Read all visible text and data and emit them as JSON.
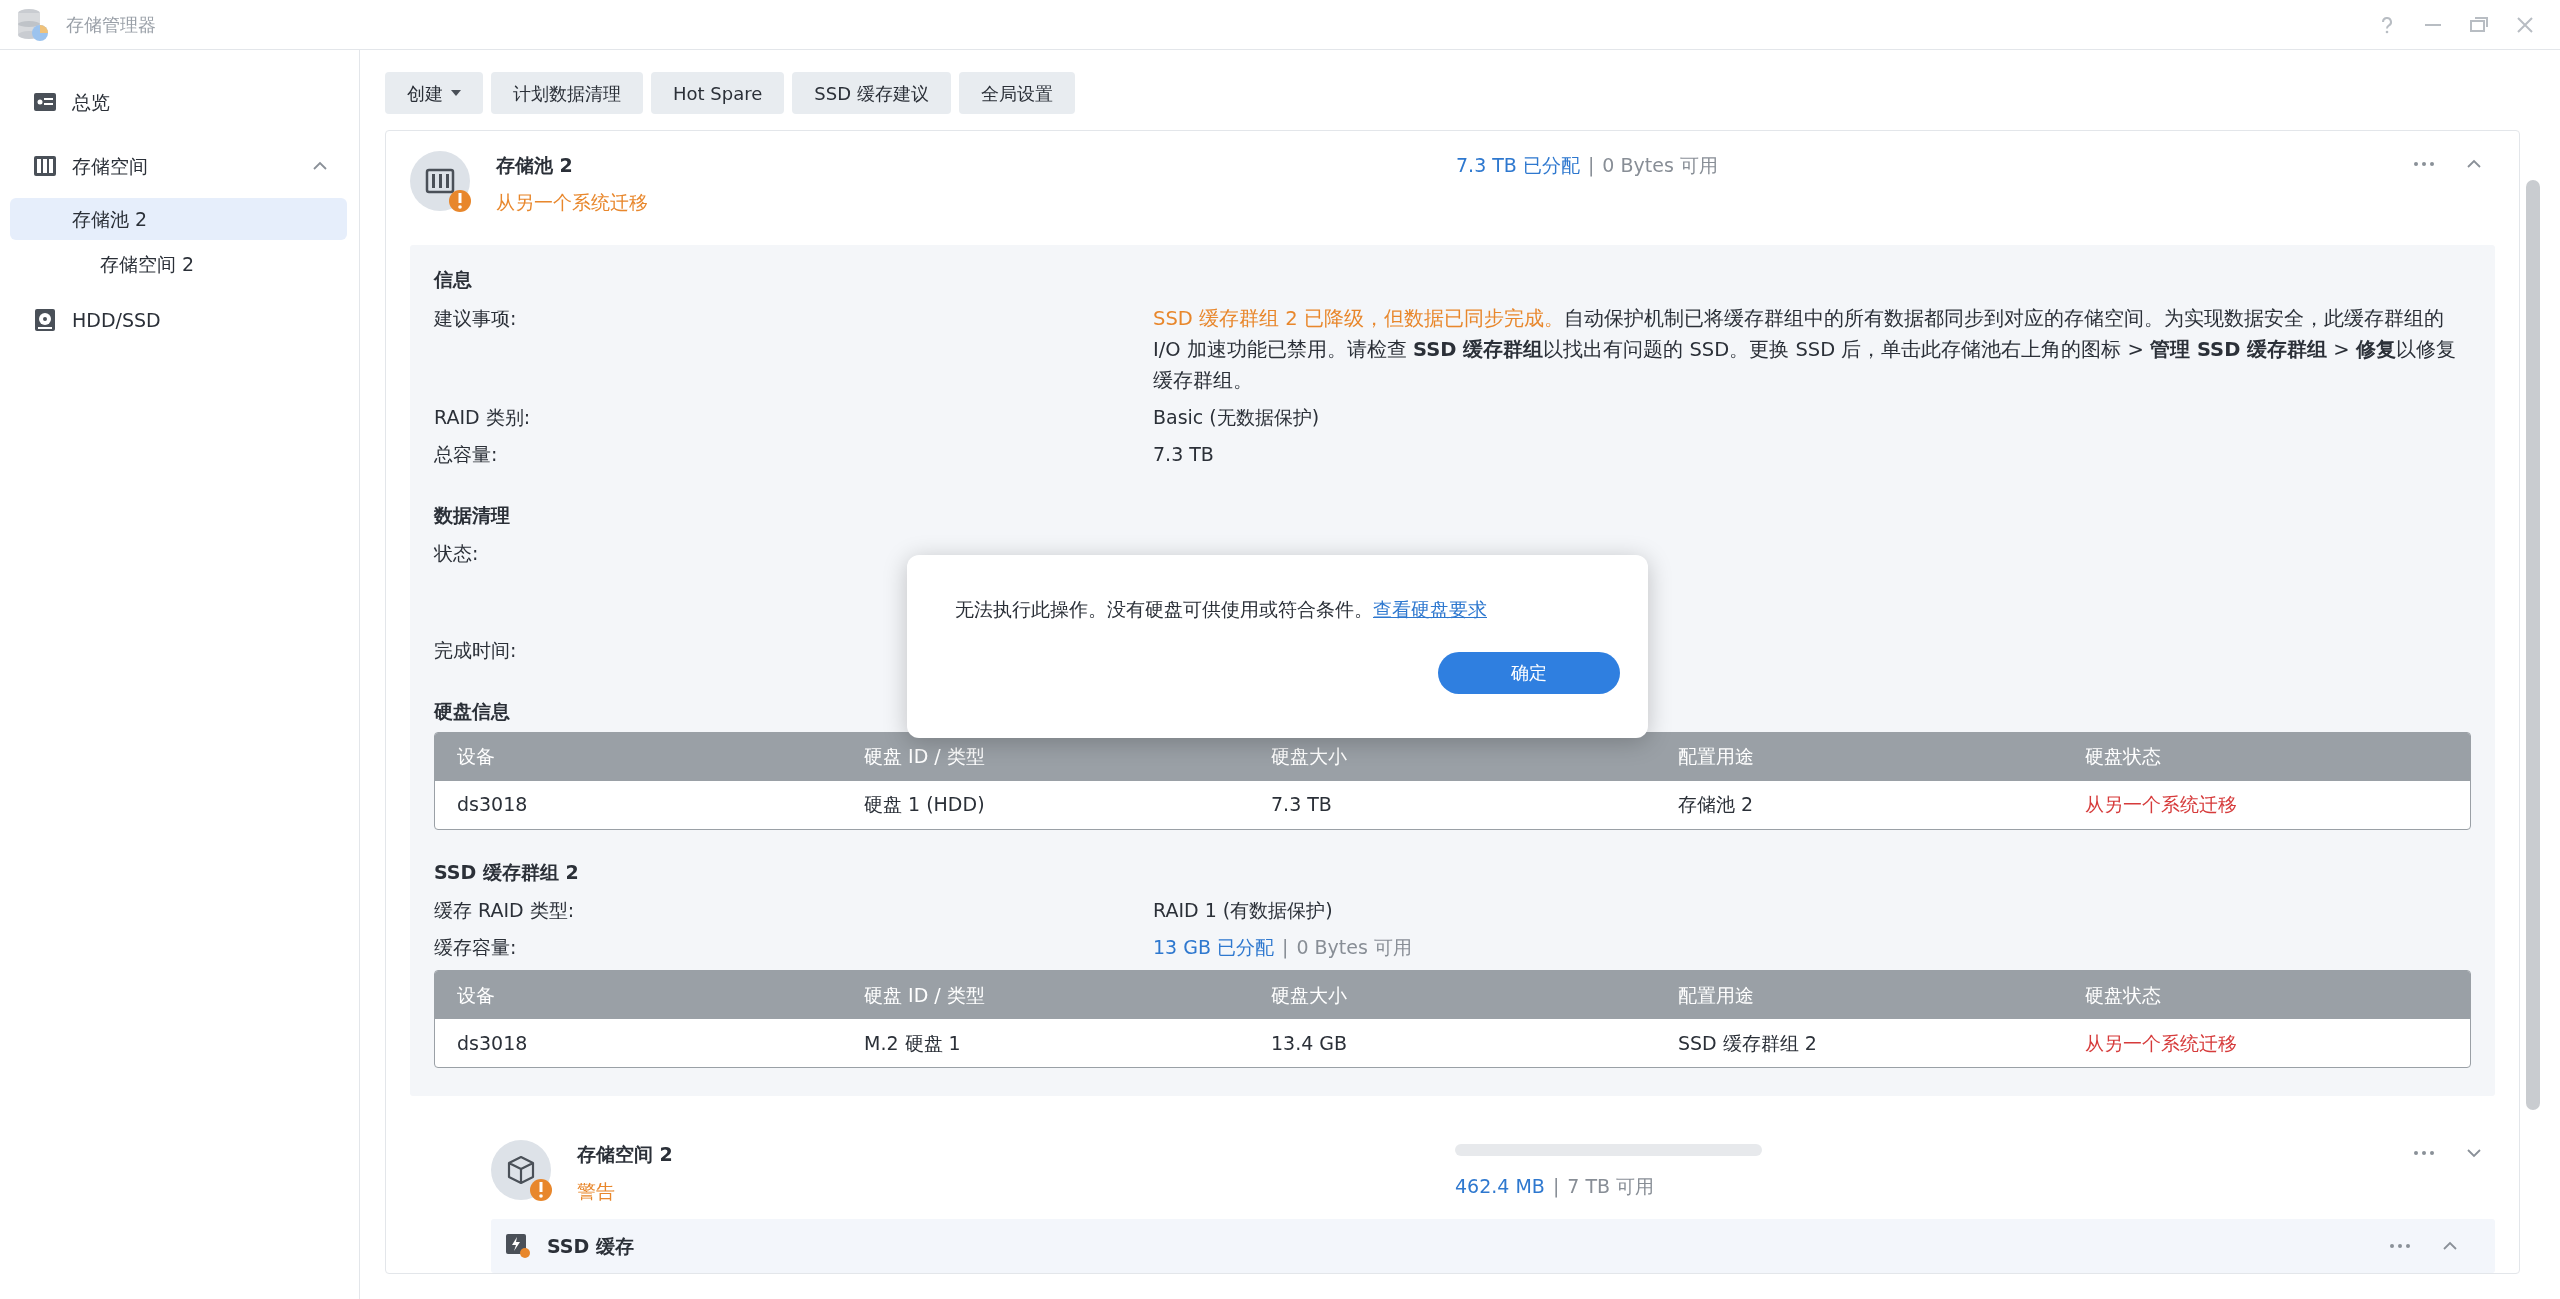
{
  "window": {
    "title": "存储管理器"
  },
  "sidebar": {
    "items": [
      {
        "label": "总览",
        "selected": false
      },
      {
        "label": "存储空间",
        "selected": false,
        "expanded": true,
        "children": [
          {
            "label": "存储池 2",
            "selected": true,
            "children": [
              {
                "label": "存储空间 2",
                "selected": false
              }
            ]
          }
        ]
      },
      {
        "label": "HDD/SSD",
        "selected": false
      }
    ]
  },
  "toolbar": [
    {
      "label": "创建",
      "dropdown": true
    },
    {
      "label": "计划数据清理",
      "dropdown": false
    },
    {
      "label": "Hot Spare",
      "dropdown": false
    },
    {
      "label": "SSD 缓存建议",
      "dropdown": false
    },
    {
      "label": "全局设置",
      "dropdown": false
    }
  ],
  "pool": {
    "name": "存储池 2",
    "status": "从另一个系统迁移",
    "warning": true,
    "allocated": "7.3 TB 已分配",
    "separator": "|",
    "available": "0 Bytes 可用",
    "expanded": true,
    "sections": [
      {
        "heading": "信息",
        "rows": [
          {
            "label": "建议事项:",
            "warning": "SSD 缓存群组 2 已降级，但数据已同步完成。",
            "value": "自动保护机制已将缓存群组中的所有数据都同步到对应的存储空间。为实现数据安全，此缓存群组的 I/O 加速功能已禁用。请检查 **SSD 缓存群组**以找出有问题的 SSD。更换 SSD 后，单击此存储池右上角的图标 > **管理 SSD 缓存群组** > **修复**以修复缓存群组。"
          },
          {
            "label": "RAID 类别:",
            "value": "Basic (无数据保护)"
          },
          {
            "label": "总容量:",
            "value": "7.3 TB"
          }
        ]
      },
      {
        "heading": "数据清理",
        "rows": [
          {
            "label": "状态:"
          },
          {
            "label": "完成时间:"
          }
        ]
      },
      {
        "heading": "硬盘信息",
        "table": {
          "columns": [
            "设备",
            "硬盘 ID / 类型",
            "硬盘大小",
            "配置用途",
            "硬盘状态"
          ],
          "rows": [
            [
              "ds3018",
              "硬盘 1 (HDD)",
              "7.3 TB",
              "存储池 2",
              "从另一个系统迁移"
            ]
          ]
        }
      },
      {
        "heading": "SSD 缓存群组 2",
        "rows": [
          {
            "label": "缓存 RAID 类型:",
            "value": "RAID 1 (有数据保护)"
          },
          {
            "label": "缓存容量:",
            "allocated": "13 GB 已分配",
            "separator": "|",
            "available": "0 Bytes 可用"
          }
        ],
        "table": {
          "columns": [
            "设备",
            "硬盘 ID / 类型",
            "硬盘大小",
            "配置用途",
            "硬盘状态"
          ],
          "rows": [
            [
              "ds3018",
              "M.2 硬盘 1",
              "13.4 GB",
              "SSD 缓存群组 2",
              "从另一个系统迁移"
            ]
          ]
        }
      }
    ]
  },
  "volume": {
    "name": "存储空间 2",
    "status": "警告",
    "warning": true,
    "level": 0,
    "allocated": "462.4 MB",
    "separator": "|",
    "available": "7 TB 可用",
    "expanded": false
  },
  "ssd_cache": {
    "title": "SSD 缓存",
    "expanded": true
  },
  "dialog": {
    "message": "无法执行此操作。没有硬盘可供使用或符合条件。",
    "link": "查看硬盘要求",
    "button": "确定"
  }
}
